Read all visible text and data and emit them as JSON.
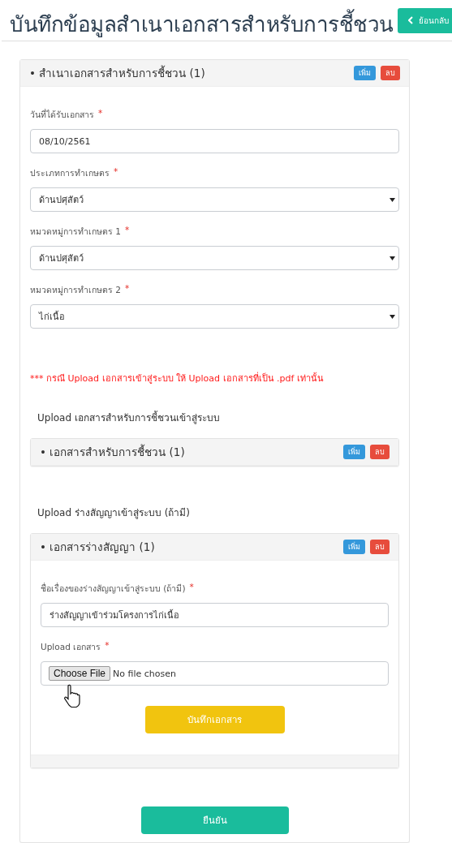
{
  "title": "บันทึกข้อมูลสำเนาเอกสารสำหรับการชี้ชวน",
  "back_button": {
    "label": "ย้อนกลับ"
  },
  "panel": {
    "title": "• สำเนาเอกสารสำหรับการชี้ชวน (1)",
    "add_button": "เพิ่ม",
    "delete_button": "ลบ",
    "fields": [
      {
        "kind": "text",
        "label": "วันที่ได้รับเอกสาร",
        "required_mark": "*",
        "value": "08/10/2561"
      },
      {
        "kind": "select",
        "label": "ประเภทการทำเกษตร",
        "required_mark": "*",
        "value": "ด้านปศุสัตว์"
      },
      {
        "kind": "select",
        "label": "หมวดหมู่การทำเกษตร 1",
        "required_mark": "*",
        "value": "ด้านปศุสัตว์"
      },
      {
        "kind": "select",
        "label": "หมวดหมู่การทำเกษตร 2",
        "required_mark": "*",
        "value": "ไก่เนื้อ"
      }
    ],
    "notice": "*** กรณี Upload เอกสารเข้าสู่ระบบ ให้ Upload เอกสารที่เป็น .pdf เท่านั้น",
    "sections": [
      {
        "heading": "Upload เอกสารสำหรับการชี้ชวนเข้าสู่ระบบ",
        "panel": {
          "title": "• เอกสารสำหรับการชี้ชวน (1)",
          "add_button": "เพิ่ม",
          "delete_button": "ลบ"
        }
      },
      {
        "heading": "Upload ร่างสัญญาเข้าสู่ระบบ (ถ้ามี)",
        "panel": {
          "title": "• เอกสารร่างสัญญา (1)",
          "add_button": "เพิ่ม",
          "delete_button": "ลบ",
          "fields": [
            {
              "kind": "text",
              "label": "ชื่อเรื่องของร่างสัญญาเข้าสู่ระบบ (ถ้ามี)",
              "required_mark": "*",
              "value": "ร่างสัญญาเข้าร่วมโครงการไก่เนื้อ"
            },
            {
              "kind": "file",
              "label": "Upload เอกสาร",
              "required_mark": "*",
              "button": "Choose File",
              "status": "No file chosen"
            }
          ],
          "save_button": "บันทึกเอกสาร"
        }
      }
    ],
    "confirm_button": "ยืนยัน"
  }
}
